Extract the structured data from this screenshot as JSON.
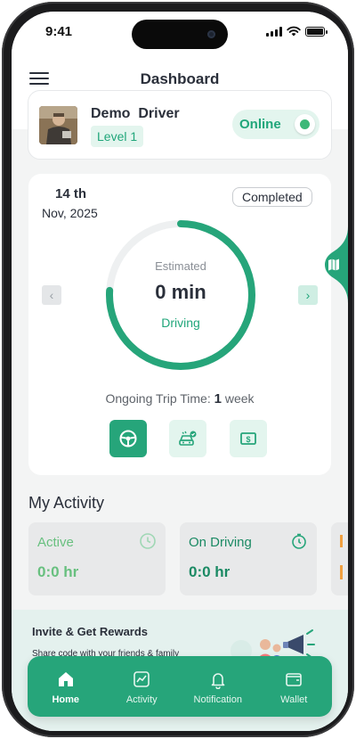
{
  "status_bar": {
    "time": "9:41"
  },
  "header": {
    "title": "Dashboard"
  },
  "driver": {
    "name": "Demo  Driver",
    "level": "Level 1",
    "status_label": "Online",
    "is_online": true
  },
  "trip": {
    "day": "14 th",
    "month_year": "Nov, 2025",
    "status": "Completed",
    "ring_label": "Estimated",
    "ring_value": "0 min",
    "ring_sublabel": "Driving",
    "ring_progress_fraction": 0.76,
    "ongoing_label": "Ongoing Trip Time:",
    "ongoing_value": "1",
    "ongoing_unit": "week"
  },
  "activity": {
    "title": "My Activity",
    "cards": [
      {
        "label": "Active",
        "value": "0:0 hr"
      },
      {
        "label": "On Driving",
        "value": "0:0 hr"
      }
    ]
  },
  "invite": {
    "title": "Invite & Get Rewards",
    "subtitle": "Share code with your friends & family"
  },
  "bottom_nav": {
    "items": [
      {
        "label": "Home",
        "icon": "home-icon"
      },
      {
        "label": "Activity",
        "icon": "activity-icon"
      },
      {
        "label": "Notification",
        "icon": "bell-icon"
      },
      {
        "label": "Wallet",
        "icon": "wallet-icon"
      }
    ],
    "selected": "Home"
  },
  "colors": {
    "accent": "#26a57a",
    "accent_soft": "#e3f5ee",
    "accent_light": "#68c07f",
    "background": "#f3f4f4"
  }
}
